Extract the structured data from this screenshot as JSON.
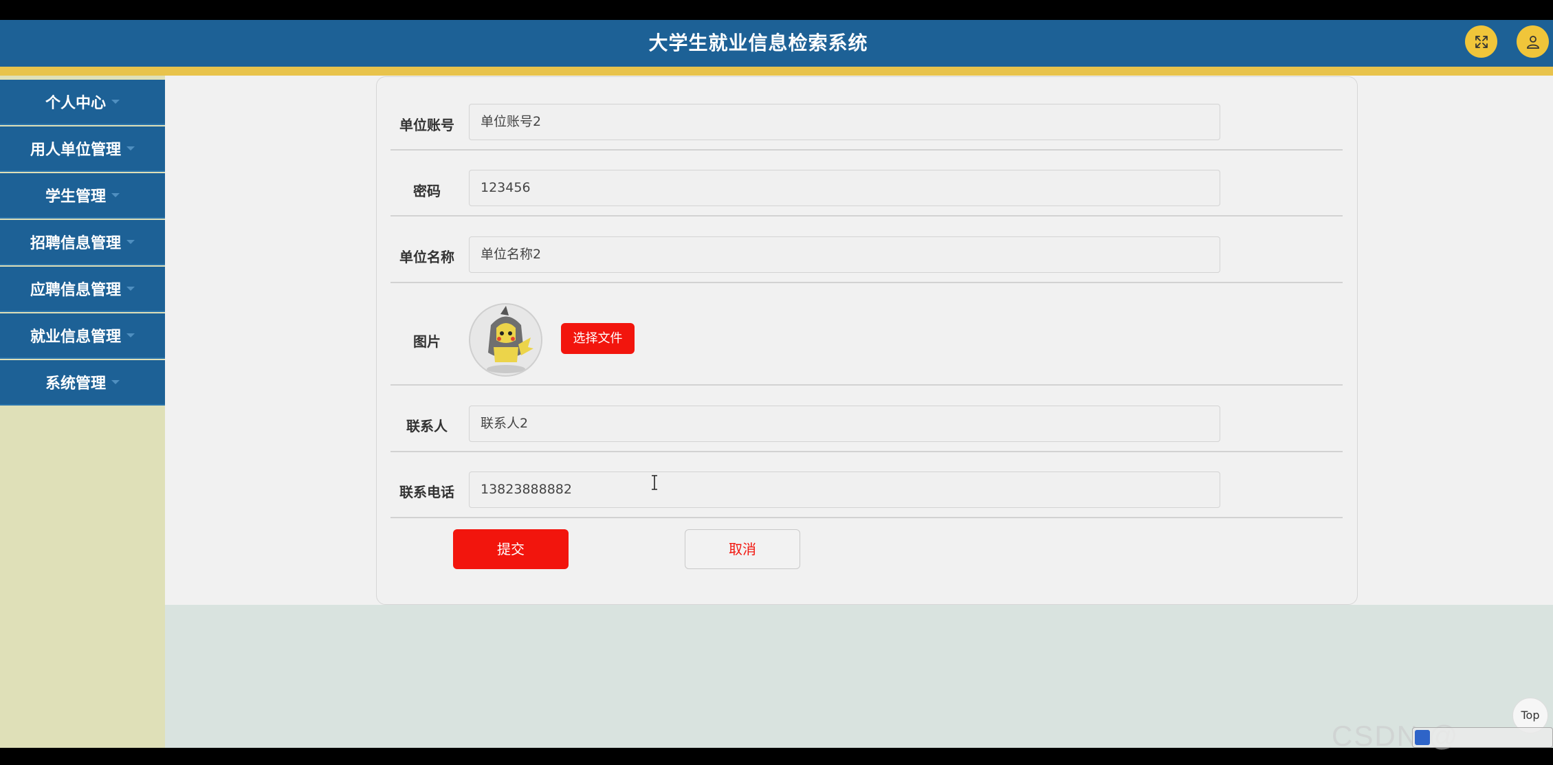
{
  "header": {
    "title": "大学生就业信息检索系统",
    "fullscreen_icon": "expand-arrows-icon",
    "user_icon": "user-icon",
    "colors": {
      "bar": "#1d6196",
      "strip": "#e8c34c",
      "buttons": "#f0c53a"
    }
  },
  "sidebar": {
    "items": [
      {
        "label": "个人中心"
      },
      {
        "label": "用人单位管理"
      },
      {
        "label": "学生管理"
      },
      {
        "label": "招聘信息管理"
      },
      {
        "label": "应聘信息管理"
      },
      {
        "label": "就业信息管理"
      },
      {
        "label": "系统管理"
      }
    ]
  },
  "form": {
    "account": {
      "label": "单位账号",
      "value": "单位账号2"
    },
    "password": {
      "label": "密码",
      "value": "123456"
    },
    "company_name": {
      "label": "单位名称",
      "value": "单位名称2"
    },
    "image": {
      "label": "图片",
      "choose_label": "选择文件"
    },
    "contact": {
      "label": "联系人",
      "value": "联系人2"
    },
    "phone": {
      "label": "联系电话",
      "value": "13823888882"
    },
    "submit_label": "提交",
    "cancel_label": "取消",
    "accent_color": "#f2150d"
  },
  "floating": {
    "top_label": "Top",
    "watermark": "CSDN @"
  }
}
